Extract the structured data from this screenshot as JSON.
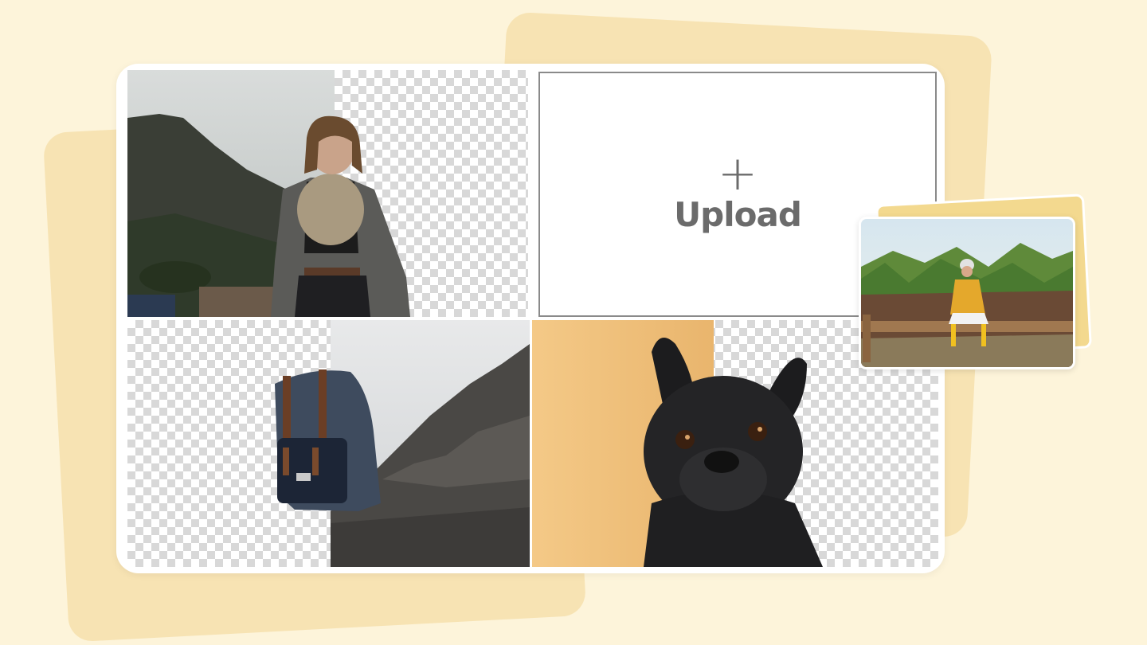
{
  "upload": {
    "plus": "+",
    "label": "Upload"
  },
  "images": [
    {
      "name": "woman-with-scarf",
      "state": "background-partially-removed"
    },
    {
      "name": "backpack-on-rocks",
      "state": "background-partially-removed"
    },
    {
      "name": "french-bulldog",
      "state": "background-partially-removed"
    },
    {
      "name": "woman-sitting-on-log-forest",
      "state": "original"
    }
  ],
  "colors": {
    "page_bg": "#fdf4da",
    "accent_card": "#f7e3b3",
    "upload_text": "#6b6b6b",
    "checker": "#d8d8d8"
  }
}
